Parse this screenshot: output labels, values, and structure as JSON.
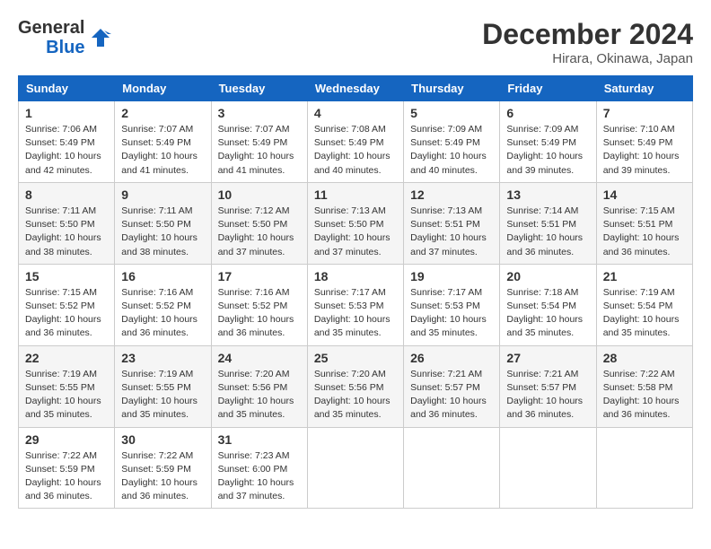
{
  "header": {
    "logo_line1": "General",
    "logo_line2": "Blue",
    "month": "December 2024",
    "location": "Hirara, Okinawa, Japan"
  },
  "days_of_week": [
    "Sunday",
    "Monday",
    "Tuesday",
    "Wednesday",
    "Thursday",
    "Friday",
    "Saturday"
  ],
  "weeks": [
    [
      {
        "day": 1,
        "sunrise": "7:06 AM",
        "sunset": "5:49 PM",
        "daylight": "10 hours and 42 minutes."
      },
      {
        "day": 2,
        "sunrise": "7:07 AM",
        "sunset": "5:49 PM",
        "daylight": "10 hours and 41 minutes."
      },
      {
        "day": 3,
        "sunrise": "7:07 AM",
        "sunset": "5:49 PM",
        "daylight": "10 hours and 41 minutes."
      },
      {
        "day": 4,
        "sunrise": "7:08 AM",
        "sunset": "5:49 PM",
        "daylight": "10 hours and 40 minutes."
      },
      {
        "day": 5,
        "sunrise": "7:09 AM",
        "sunset": "5:49 PM",
        "daylight": "10 hours and 40 minutes."
      },
      {
        "day": 6,
        "sunrise": "7:09 AM",
        "sunset": "5:49 PM",
        "daylight": "10 hours and 39 minutes."
      },
      {
        "day": 7,
        "sunrise": "7:10 AM",
        "sunset": "5:49 PM",
        "daylight": "10 hours and 39 minutes."
      }
    ],
    [
      {
        "day": 8,
        "sunrise": "7:11 AM",
        "sunset": "5:50 PM",
        "daylight": "10 hours and 38 minutes."
      },
      {
        "day": 9,
        "sunrise": "7:11 AM",
        "sunset": "5:50 PM",
        "daylight": "10 hours and 38 minutes."
      },
      {
        "day": 10,
        "sunrise": "7:12 AM",
        "sunset": "5:50 PM",
        "daylight": "10 hours and 37 minutes."
      },
      {
        "day": 11,
        "sunrise": "7:13 AM",
        "sunset": "5:50 PM",
        "daylight": "10 hours and 37 minutes."
      },
      {
        "day": 12,
        "sunrise": "7:13 AM",
        "sunset": "5:51 PM",
        "daylight": "10 hours and 37 minutes."
      },
      {
        "day": 13,
        "sunrise": "7:14 AM",
        "sunset": "5:51 PM",
        "daylight": "10 hours and 36 minutes."
      },
      {
        "day": 14,
        "sunrise": "7:15 AM",
        "sunset": "5:51 PM",
        "daylight": "10 hours and 36 minutes."
      }
    ],
    [
      {
        "day": 15,
        "sunrise": "7:15 AM",
        "sunset": "5:52 PM",
        "daylight": "10 hours and 36 minutes."
      },
      {
        "day": 16,
        "sunrise": "7:16 AM",
        "sunset": "5:52 PM",
        "daylight": "10 hours and 36 minutes."
      },
      {
        "day": 17,
        "sunrise": "7:16 AM",
        "sunset": "5:52 PM",
        "daylight": "10 hours and 36 minutes."
      },
      {
        "day": 18,
        "sunrise": "7:17 AM",
        "sunset": "5:53 PM",
        "daylight": "10 hours and 35 minutes."
      },
      {
        "day": 19,
        "sunrise": "7:17 AM",
        "sunset": "5:53 PM",
        "daylight": "10 hours and 35 minutes."
      },
      {
        "day": 20,
        "sunrise": "7:18 AM",
        "sunset": "5:54 PM",
        "daylight": "10 hours and 35 minutes."
      },
      {
        "day": 21,
        "sunrise": "7:19 AM",
        "sunset": "5:54 PM",
        "daylight": "10 hours and 35 minutes."
      }
    ],
    [
      {
        "day": 22,
        "sunrise": "7:19 AM",
        "sunset": "5:55 PM",
        "daylight": "10 hours and 35 minutes."
      },
      {
        "day": 23,
        "sunrise": "7:19 AM",
        "sunset": "5:55 PM",
        "daylight": "10 hours and 35 minutes."
      },
      {
        "day": 24,
        "sunrise": "7:20 AM",
        "sunset": "5:56 PM",
        "daylight": "10 hours and 35 minutes."
      },
      {
        "day": 25,
        "sunrise": "7:20 AM",
        "sunset": "5:56 PM",
        "daylight": "10 hours and 35 minutes."
      },
      {
        "day": 26,
        "sunrise": "7:21 AM",
        "sunset": "5:57 PM",
        "daylight": "10 hours and 36 minutes."
      },
      {
        "day": 27,
        "sunrise": "7:21 AM",
        "sunset": "5:57 PM",
        "daylight": "10 hours and 36 minutes."
      },
      {
        "day": 28,
        "sunrise": "7:22 AM",
        "sunset": "5:58 PM",
        "daylight": "10 hours and 36 minutes."
      }
    ],
    [
      {
        "day": 29,
        "sunrise": "7:22 AM",
        "sunset": "5:59 PM",
        "daylight": "10 hours and 36 minutes."
      },
      {
        "day": 30,
        "sunrise": "7:22 AM",
        "sunset": "5:59 PM",
        "daylight": "10 hours and 36 minutes."
      },
      {
        "day": 31,
        "sunrise": "7:23 AM",
        "sunset": "6:00 PM",
        "daylight": "10 hours and 37 minutes."
      },
      null,
      null,
      null,
      null
    ]
  ]
}
